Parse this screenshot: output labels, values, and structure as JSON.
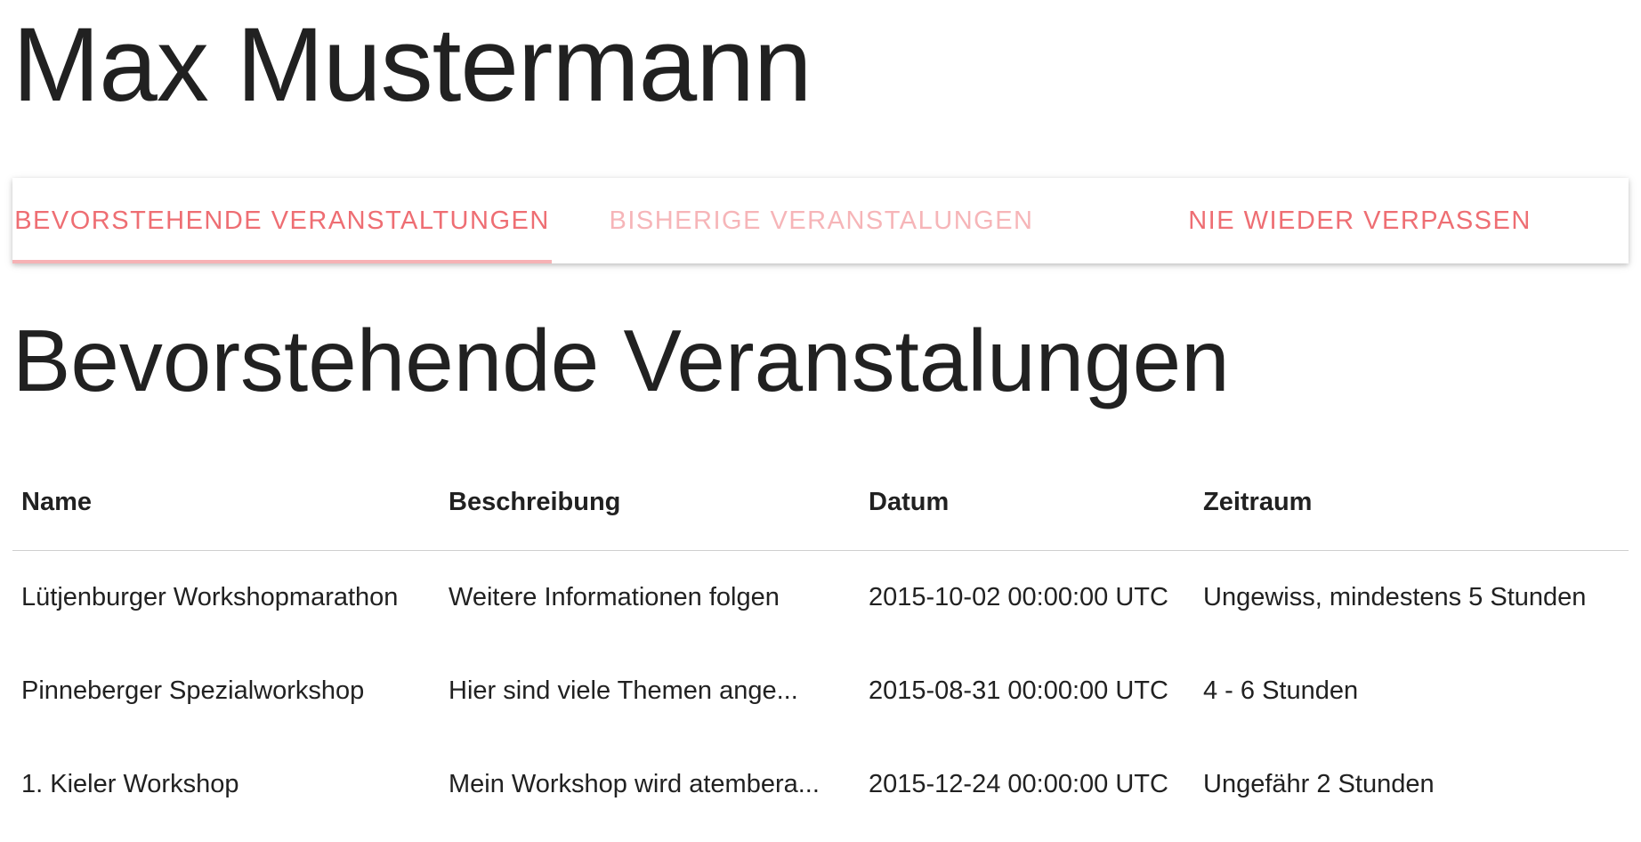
{
  "profile": {
    "name": "Max Mustermann"
  },
  "tabs": [
    {
      "label": "BEVORSTEHENDE VERANSTALTUNGEN",
      "active": true
    },
    {
      "label": "BISHERIGE VERANSTALUNGEN",
      "active": false
    },
    {
      "label": "NIE WIEDER VERPASSEN",
      "active": false
    }
  ],
  "colors": {
    "accent": "#ee6e73",
    "indicator": "#f6b2b5",
    "text": "#212121"
  },
  "section": {
    "heading": "Bevorstehende Veranstalungen"
  },
  "table": {
    "headers": {
      "name": "Name",
      "description": "Beschreibung",
      "date": "Datum",
      "duration": "Zeitraum"
    },
    "rows": [
      {
        "name": "Lütjenburger Workshopmarathon",
        "description": "Weitere Informationen folgen",
        "date": "2015-10-02 00:00:00 UTC",
        "duration": "Ungewiss, mindestens 5 Stunden"
      },
      {
        "name": "Pinneberger Spezialworkshop",
        "description": "Hier sind viele Themen ange...",
        "date": "2015-08-31 00:00:00 UTC",
        "duration": "4 - 6 Stunden"
      },
      {
        "name": "1. Kieler Workshop",
        "description": "Mein Workshop wird atembera...",
        "date": "2015-12-24 00:00:00 UTC",
        "duration": "Ungefähr 2 Stunden"
      }
    ]
  }
}
